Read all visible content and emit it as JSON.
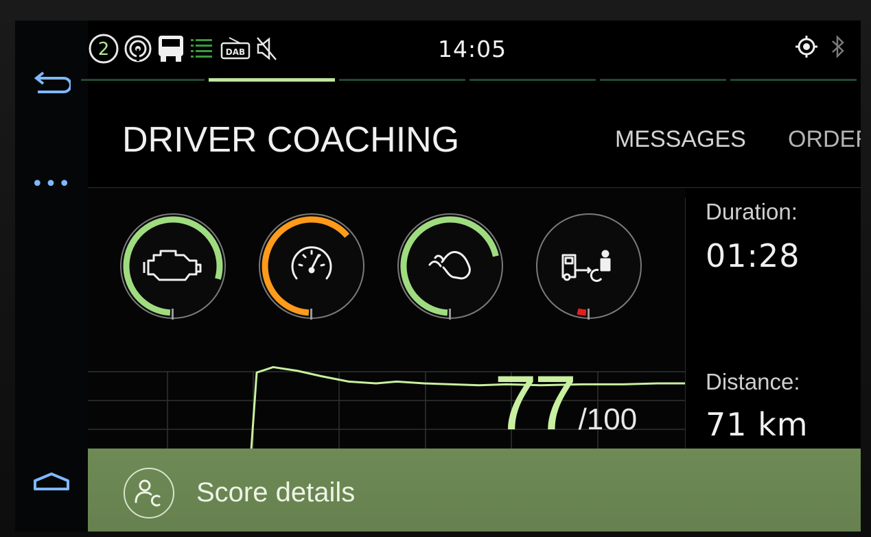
{
  "status_bar": {
    "time": "14:05",
    "channel_number": "2",
    "radio_source": "DAB",
    "left_icons": [
      "channel-badge-icon",
      "signal-icon",
      "truck-icon",
      "equalizer-icon",
      "dab-radio-icon",
      "mute-icon"
    ],
    "right_icons": [
      "gps-icon",
      "bluetooth-icon"
    ]
  },
  "header": {
    "title": "DRIVER COACHING",
    "tabs": [
      {
        "label": "MESSAGES"
      },
      {
        "label": "ORDER"
      }
    ]
  },
  "nav_rail": {
    "items": [
      "back-icon",
      "more-icon",
      "home-icon"
    ],
    "more_glyph": "•••"
  },
  "gauges": [
    {
      "name": "engine",
      "icon": "engine-icon",
      "level": 0.8,
      "color": "#9fdc80"
    },
    {
      "name": "speed",
      "icon": "speedometer-icon",
      "level": 0.64,
      "color": "#ff9a1a"
    },
    {
      "name": "coasting",
      "icon": "hill-icon",
      "level": 0.72,
      "color": "#9fdc80"
    },
    {
      "name": "anticipation",
      "icon": "truck-distance-icon",
      "level": 0.03,
      "color": "#e02020"
    }
  ],
  "score": {
    "value": "77",
    "max": "/100"
  },
  "info": {
    "duration_label": "Duration:",
    "duration_value": "01:28",
    "distance_label": "Distance:",
    "distance_value": "71 km"
  },
  "bottom_bar": {
    "label": "Score details",
    "icon": "score-details-icon"
  },
  "colors": {
    "accent_green": "#9fdc80",
    "warning_orange": "#ff9a1a",
    "alert_red": "#e02020",
    "bottom_bar": "#6e8a55",
    "nav_blue": "#7fb8ff"
  },
  "chart_data": {
    "type": "line",
    "series": [
      {
        "values": [
          0,
          0,
          90,
          96,
          92,
          86,
          80,
          78,
          80,
          78,
          77,
          76,
          77,
          76,
          77,
          77,
          78,
          78
        ]
      }
    ],
    "ylim": [
      0,
      100
    ],
    "grid": true
  }
}
